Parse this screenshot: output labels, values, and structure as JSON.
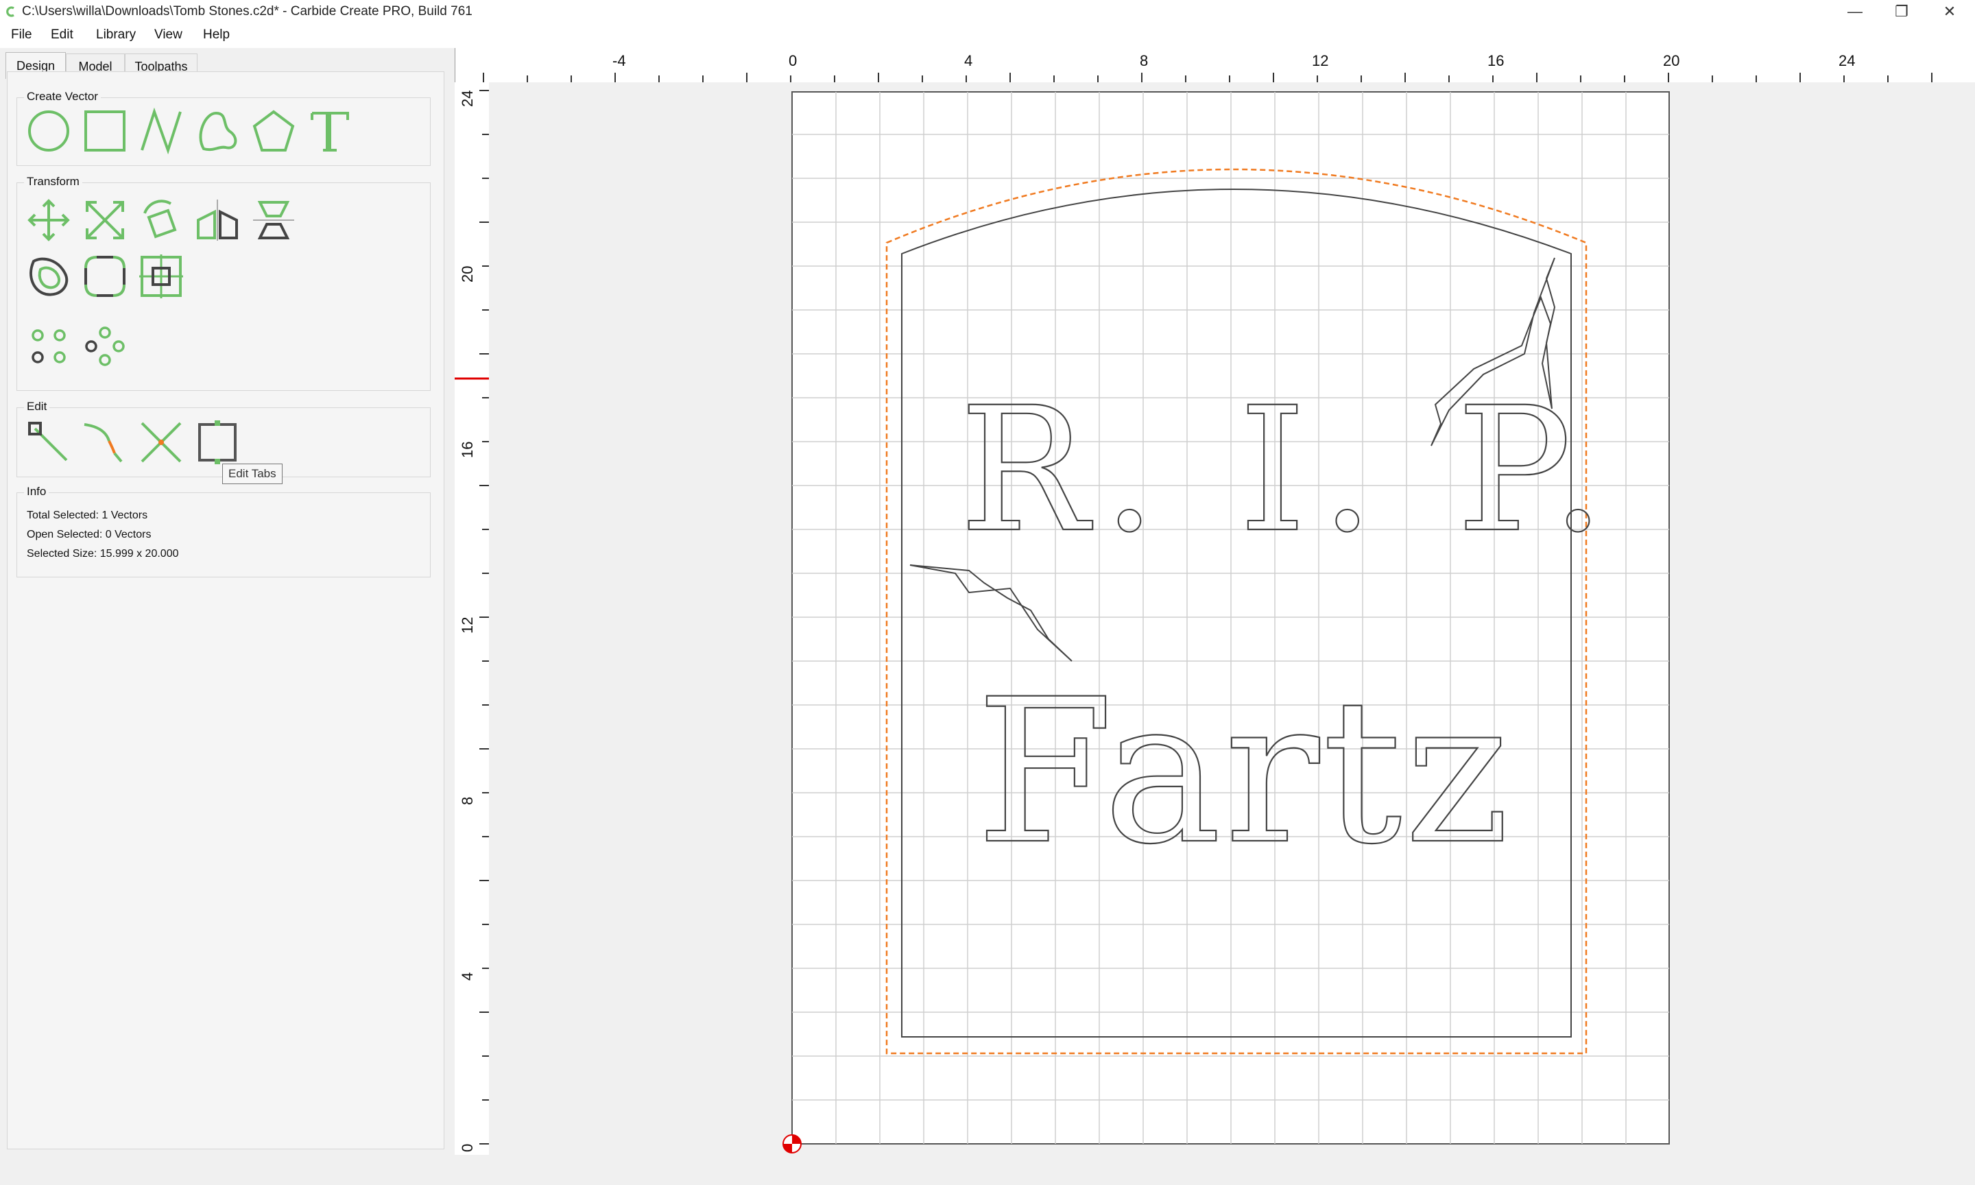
{
  "window": {
    "title": "C:\\Users\\willa\\Downloads\\Tomb Stones.c2d* - Carbide Create PRO, Build 761",
    "minimize": "—",
    "restore": "❐",
    "close": "✕"
  },
  "menu": [
    "File",
    "Edit",
    "Library",
    "View",
    "Help"
  ],
  "tabs": [
    "Design",
    "Model",
    "Toolpaths"
  ],
  "groups": {
    "create_vector": "Create Vector",
    "transform": "Transform",
    "edit": "Edit",
    "info": "Info"
  },
  "info": {
    "total_selected": "Total Selected:  1 Vectors",
    "open_selected": "Open Selected:  0 Vectors",
    "selected_size": "Selected Size:   15.999 x 20.000"
  },
  "tooltip": "Edit Tabs",
  "ruler": {
    "top_labels": [
      "-4",
      "0",
      "4",
      "8",
      "12",
      "16",
      "20",
      "24"
    ],
    "left_labels": [
      "24",
      "20",
      "16",
      "12",
      "8",
      "4",
      "0"
    ]
  },
  "design": {
    "line1": "R. I. P.",
    "line2": "Fartz"
  },
  "colors": {
    "accent": "#6dbf67",
    "toolpath": "#f07a20",
    "vector": "#444444"
  }
}
